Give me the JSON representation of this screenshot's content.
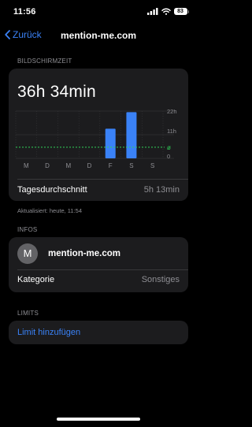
{
  "status_bar": {
    "time": "11:56",
    "battery": "83"
  },
  "nav": {
    "back_label": "Zurück",
    "title": "mention-me.com"
  },
  "screen_time": {
    "section_label": "BILDSCHIRMZEIT",
    "total": "36h 34min",
    "average_label": "Tagesdurchschnitt",
    "average_value": "5h 13min",
    "updated": "Aktualisiert: heute, 11:54"
  },
  "chart_data": {
    "type": "bar",
    "categories": [
      "M",
      "D",
      "M",
      "D",
      "F",
      "S",
      "S"
    ],
    "values": [
      0,
      0,
      0,
      0,
      13.8,
      21.5,
      0
    ],
    "unit": "h",
    "y_ticks": [
      "22h",
      "11h",
      "0"
    ],
    "ylim": [
      0,
      22
    ],
    "average_value": 5.2,
    "average_marker": "ø",
    "colors": {
      "bar": "#3a82f7",
      "average": "#30d158",
      "grid": "#3a3a3c",
      "text": "#8e8e93"
    }
  },
  "infos": {
    "section_label": "INFOS",
    "avatar_letter": "M",
    "app_name": "mention-me.com",
    "category_label": "Kategorie",
    "category_value": "Sonstiges"
  },
  "limits": {
    "section_label": "LIMITS",
    "add_label": "Limit hinzufügen"
  },
  "colors": {
    "accent": "#3a82f7",
    "card": "#1c1c1e",
    "secondary_text": "#8e8e93"
  }
}
